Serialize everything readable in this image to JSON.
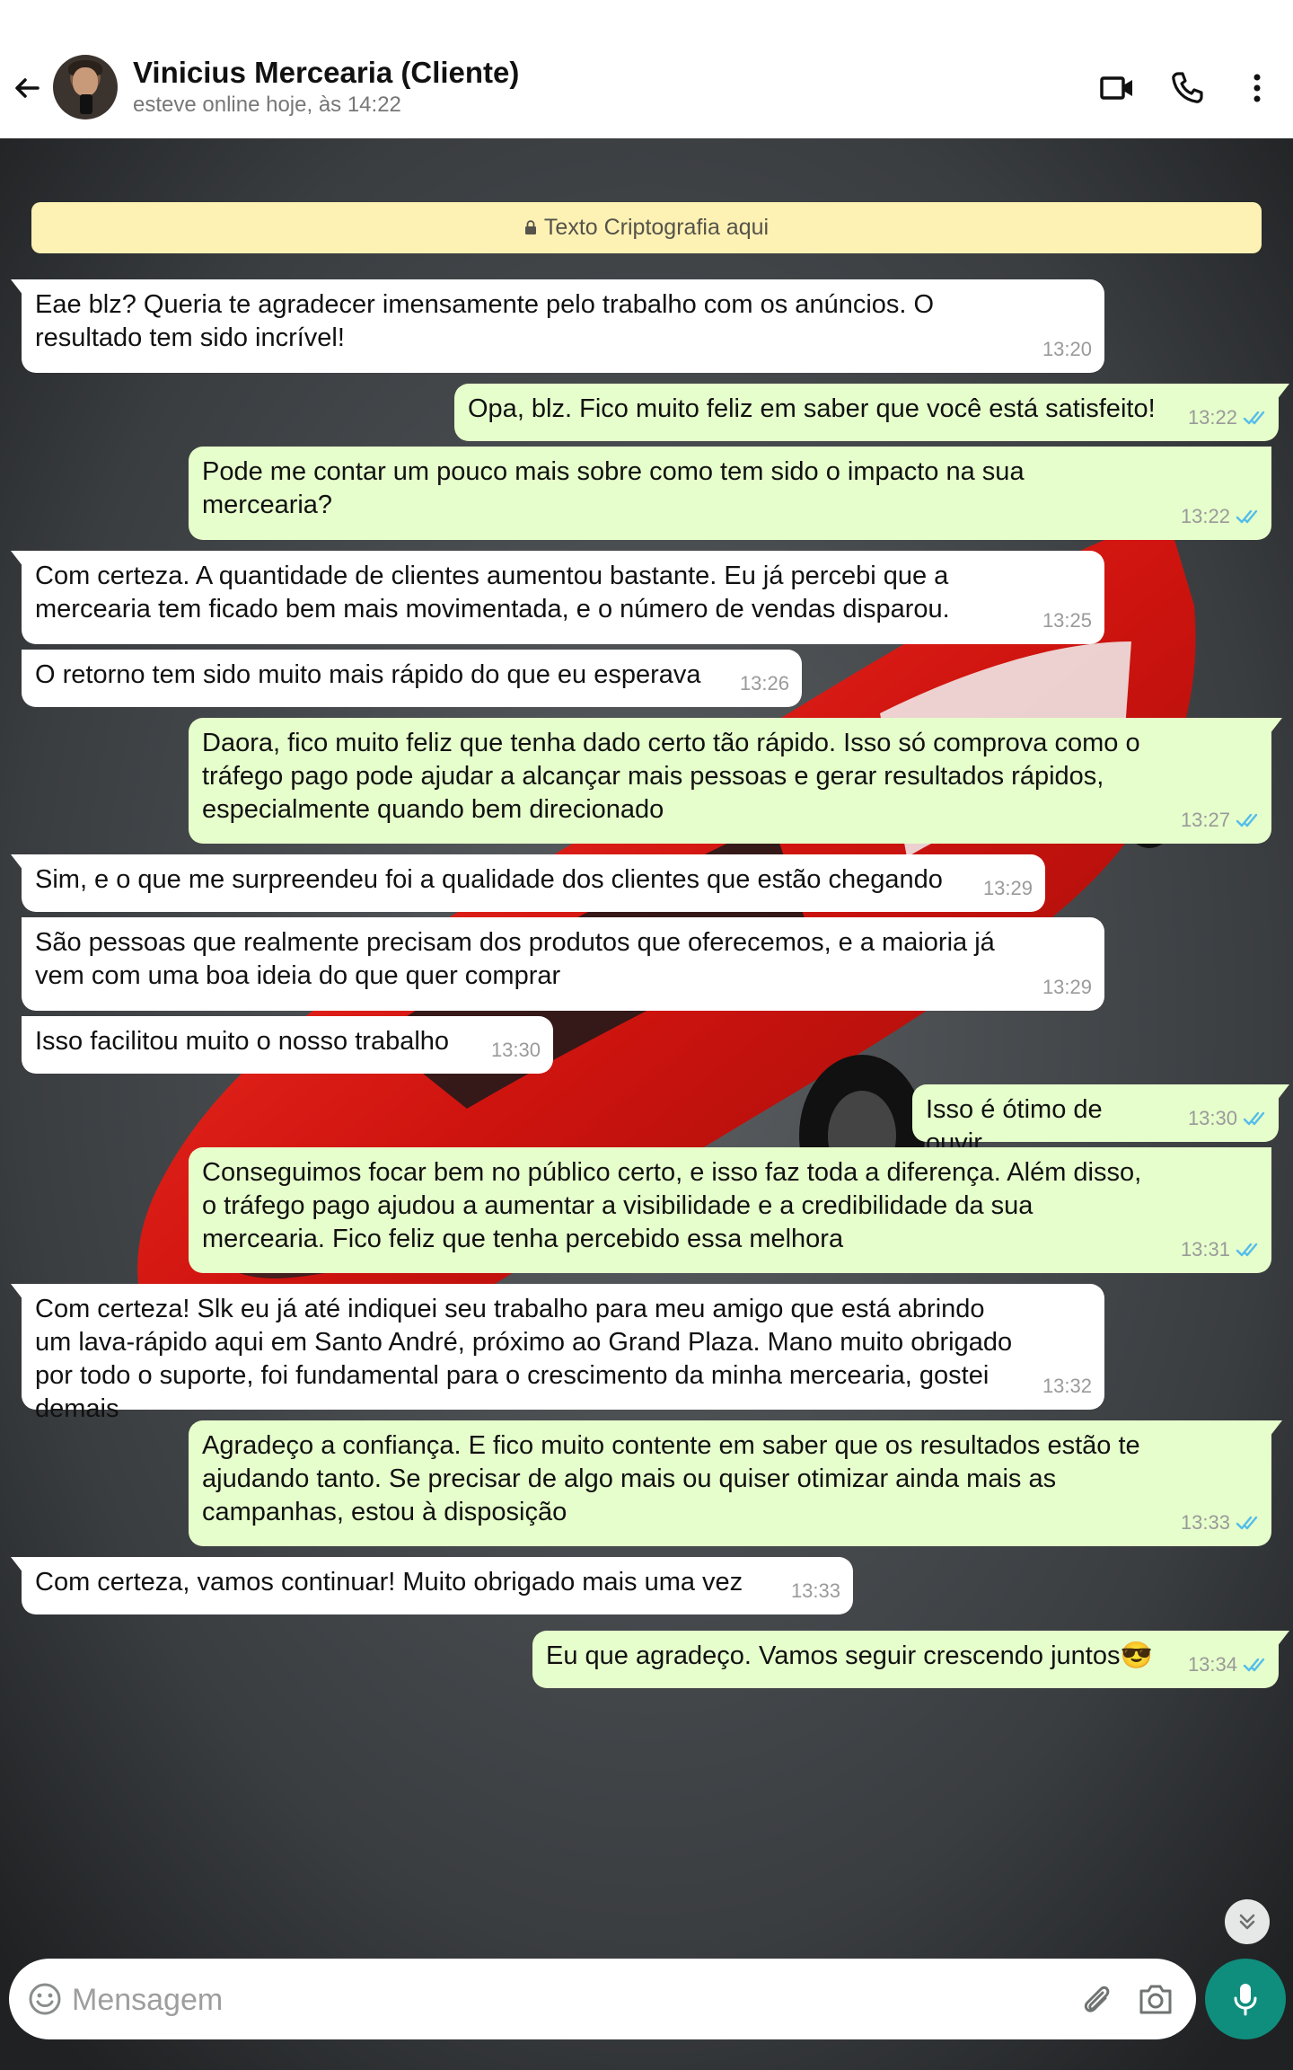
{
  "header": {
    "contact_name": "Vinicius Mercearia (Cliente)",
    "status": "esteve online hoje, às 14:22",
    "icons": [
      "back-arrow-icon",
      "video-call-icon",
      "phone-call-icon",
      "more-options-icon"
    ]
  },
  "chat": {
    "encryption_notice": "Texto Criptografia aqui",
    "messages": [
      {
        "direction": "in",
        "text": "Eae blz? Queria te agradecer imensamente pelo trabalho com os anúncios. O resultado tem sido incrível!",
        "time": "13:20"
      },
      {
        "direction": "out",
        "text": "Opa, blz. Fico muito feliz em saber que você está satisfeito!",
        "time": "13:22",
        "status": "read"
      },
      {
        "direction": "out",
        "text": "Pode me contar um pouco mais sobre como tem sido o impacto na sua mercearia?",
        "time": "13:22",
        "status": "read"
      },
      {
        "direction": "in",
        "text": "Com certeza. A quantidade de clientes aumentou bastante. Eu já percebi que a mercearia tem ficado bem mais movimentada, e o número de vendas disparou.",
        "time": "13:25"
      },
      {
        "direction": "in",
        "text": "O retorno tem sido muito mais rápido do que eu esperava",
        "time": "13:26"
      },
      {
        "direction": "out",
        "text": "Daora, fico muito feliz que tenha dado certo tão rápido. Isso só comprova como o tráfego pago pode ajudar a alcançar mais pessoas e gerar resultados rápidos, especialmente quando bem direcionado",
        "time": "13:27",
        "status": "read"
      },
      {
        "direction": "in",
        "text": "Sim, e o que me surpreendeu foi a qualidade dos clientes que estão chegando",
        "time": "13:29"
      },
      {
        "direction": "in",
        "text": "São pessoas que realmente precisam dos produtos que oferecemos, e a maioria já vem com uma boa ideia do que quer comprar",
        "time": "13:29"
      },
      {
        "direction": "in",
        "text": "Isso facilitou muito o nosso trabalho",
        "time": "13:30"
      },
      {
        "direction": "out",
        "text": "Isso é ótimo de ouvir",
        "time": "13:30",
        "status": "read"
      },
      {
        "direction": "out",
        "text": "Conseguimos focar bem no público certo, e isso faz toda a diferença. Além disso, o tráfego pago ajudou a aumentar a visibilidade e a credibilidade da sua mercearia. Fico feliz que tenha percebido essa melhora",
        "time": "13:31",
        "status": "read"
      },
      {
        "direction": "in",
        "text": "Com certeza! Slk eu já até indiquei seu trabalho para meu amigo que está abrindo um lava-rápido aqui em Santo André, próximo ao Grand Plaza. Mano muito obrigado por todo o suporte, foi fundamental para o crescimento da minha mercearia, gostei demais",
        "time": "13:32"
      },
      {
        "direction": "out",
        "text": "Agradeço a confiança. E fico muito contente em saber que os resultados estão te ajudando tanto. Se precisar de algo mais ou quiser otimizar ainda mais as campanhas, estou à disposição",
        "time": "13:33",
        "status": "read"
      },
      {
        "direction": "in",
        "text": "Com certeza, vamos continuar! Muito obrigado mais uma vez",
        "time": "13:33"
      },
      {
        "direction": "out",
        "text": "Eu que agradeço. Vamos seguir crescendo juntos😎",
        "time": "13:34",
        "status": "read"
      }
    ],
    "read_tick_color": "#53bdeb",
    "incoming_bubble_color": "#ffffff",
    "outgoing_bubble_color": "#e6fecb"
  },
  "input_bar": {
    "placeholder": "Mensagem",
    "icons": [
      "emoji-icon",
      "attach-icon",
      "camera-icon",
      "mic-icon"
    ],
    "send_button_color": "#0f8e7d"
  }
}
